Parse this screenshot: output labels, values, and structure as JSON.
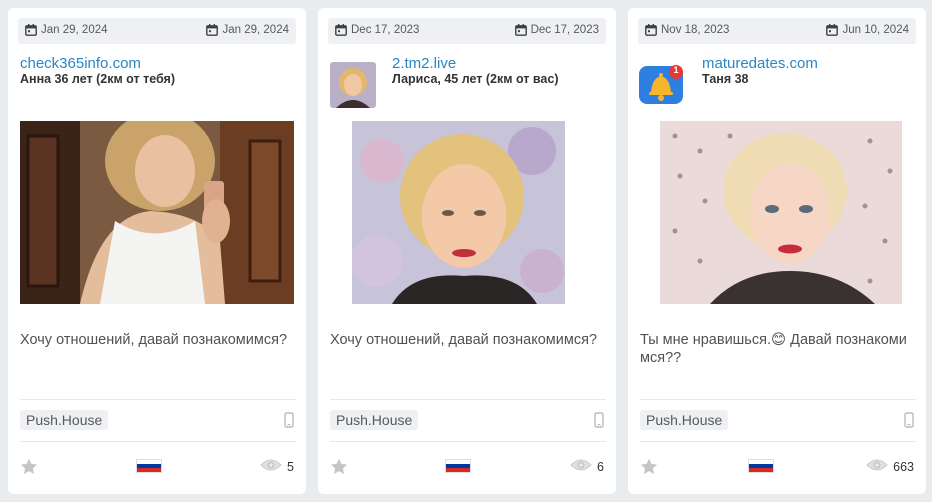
{
  "cards": [
    {
      "date_start": "Jan 29, 2024",
      "date_end": "Jan 29, 2024",
      "source": "check365info.com",
      "person": "Анна 36 лет (2км от тебя)",
      "message": "Хочу отношений, давай познакомимся?",
      "tag": "Push.House",
      "views": "5"
    },
    {
      "date_start": "Dec 17, 2023",
      "date_end": "Dec 17, 2023",
      "source": "2.tm2.live",
      "person": "Лариса, 45 лет (2км от вас)",
      "message": "Хочу отношений, давай познакомимся?",
      "tag": "Push.House",
      "views": "6"
    },
    {
      "date_start": "Nov 18, 2023",
      "date_end": "Jun 10, 2024",
      "source": "maturedates.com",
      "person": "Таня 38",
      "message": "Ты мне нравишься.😊 Давай познакомимся??",
      "tag": "Push.House",
      "views": "663",
      "badge": "1"
    }
  ],
  "colors": {
    "background": "#e9ecef",
    "card": "#ffffff",
    "link": "#2a86c4",
    "date_bar": "#eef0f3",
    "icon_gray": "#b8bcc0"
  },
  "icons": {
    "date": "calendar-icon",
    "device": "mobile-phone-icon",
    "favorite": "star-icon",
    "country": "russia-flag-icon",
    "views": "eye-icon",
    "notification": "bell-icon"
  }
}
